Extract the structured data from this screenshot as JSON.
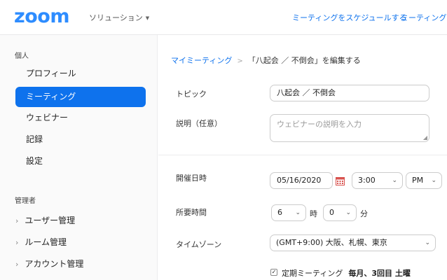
{
  "header": {
    "logo": "zoom",
    "solutions_label": "ソリューション",
    "links": [
      "ミーティングをスケジュールする",
      "ミーティングに参"
    ]
  },
  "sidebar": {
    "personal_label": "個人",
    "items": [
      {
        "label": "プロフィール",
        "active": false
      },
      {
        "label": "ミーティング",
        "active": true
      },
      {
        "label": "ウェビナー",
        "active": false
      },
      {
        "label": "記録",
        "active": false
      },
      {
        "label": "設定",
        "active": false
      }
    ],
    "admin_label": "管理者",
    "admin_items": [
      "ユーザー管理",
      "ルーム管理",
      "アカウント管理"
    ]
  },
  "breadcrumb": {
    "parent": "マイミーティング",
    "separator": ">",
    "current": "「八起会 ／ 不倒会」を編集する"
  },
  "form": {
    "topic_label": "トピック",
    "topic_value": "八起会 ／ 不倒会",
    "desc_label": "説明（任意）",
    "desc_placeholder": "ウェビナーの説明を入力",
    "when_label": "開催日時",
    "date_value": "05/16/2020",
    "time_value": "3:00",
    "ampm_value": "PM",
    "duration_label": "所要時間",
    "hours_value": "6",
    "hours_unit": "時",
    "minutes_value": "0",
    "minutes_unit": "分",
    "timezone_label": "タイムゾーン",
    "timezone_value": "(GMT+9:00) 大阪、札幌、東京",
    "recurring_label": "定期ミーティング",
    "recurring_checked": true,
    "recurring_detail": "毎月、3回目 土曜"
  },
  "colors": {
    "brand": "#2d8cff",
    "accent": "#0e72ed"
  }
}
